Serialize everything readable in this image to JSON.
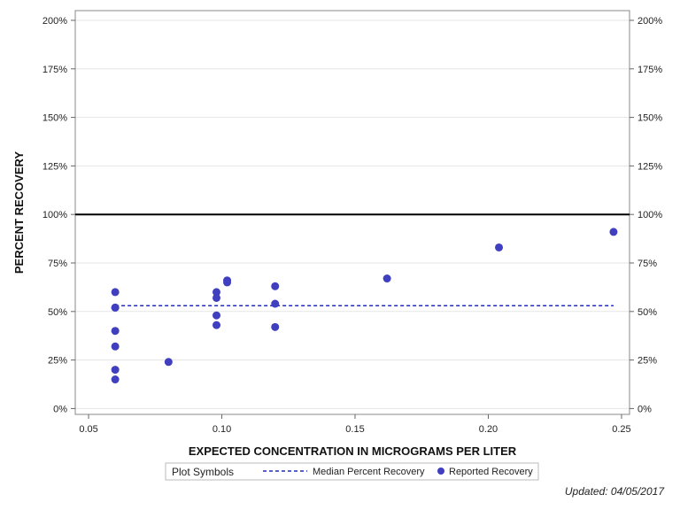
{
  "chart_data": {
    "type": "scatter",
    "xlabel": "EXPECTED CONCENTRATION IN MICROGRAMS PER LITER",
    "ylabel": "PERCENT RECOVERY",
    "xlim": [
      0.045,
      0.253
    ],
    "ylim": [
      -3,
      205
    ],
    "x_ticks": [
      0.05,
      0.1,
      0.15,
      0.2,
      0.25
    ],
    "x_tick_labels": [
      "0.05",
      "0.10",
      "0.15",
      "0.20",
      "0.25"
    ],
    "y_ticks": [
      0,
      25,
      50,
      75,
      100,
      125,
      150,
      175,
      200
    ],
    "y_tick_labels": [
      "0%",
      "25%",
      "50%",
      "75%",
      "100%",
      "125%",
      "150%",
      "175%",
      "200%"
    ],
    "grid": true,
    "reference_line": 100,
    "median_line": {
      "name": "Median Percent Recovery",
      "value": 53,
      "x_range": [
        0.06,
        0.247
      ],
      "color": "#1f2bbf"
    },
    "series": [
      {
        "name": "Reported Recovery",
        "color": "#3f3fbf",
        "points": [
          {
            "x": 0.06,
            "y": 60
          },
          {
            "x": 0.06,
            "y": 52
          },
          {
            "x": 0.06,
            "y": 52
          },
          {
            "x": 0.06,
            "y": 40
          },
          {
            "x": 0.06,
            "y": 32
          },
          {
            "x": 0.06,
            "y": 20
          },
          {
            "x": 0.06,
            "y": 15
          },
          {
            "x": 0.08,
            "y": 24
          },
          {
            "x": 0.098,
            "y": 60
          },
          {
            "x": 0.098,
            "y": 57
          },
          {
            "x": 0.098,
            "y": 48
          },
          {
            "x": 0.098,
            "y": 43
          },
          {
            "x": 0.102,
            "y": 66
          },
          {
            "x": 0.102,
            "y": 65
          },
          {
            "x": 0.12,
            "y": 63
          },
          {
            "x": 0.12,
            "y": 54
          },
          {
            "x": 0.12,
            "y": 42
          },
          {
            "x": 0.162,
            "y": 67
          },
          {
            "x": 0.204,
            "y": 83
          },
          {
            "x": 0.247,
            "y": 91
          }
        ]
      }
    ],
    "legend": {
      "title": "Plot Symbols",
      "position": "bottom",
      "entries": [
        "Median Percent Recovery",
        "Reported Recovery"
      ]
    }
  },
  "footnote": "Updated: 04/05/2017"
}
